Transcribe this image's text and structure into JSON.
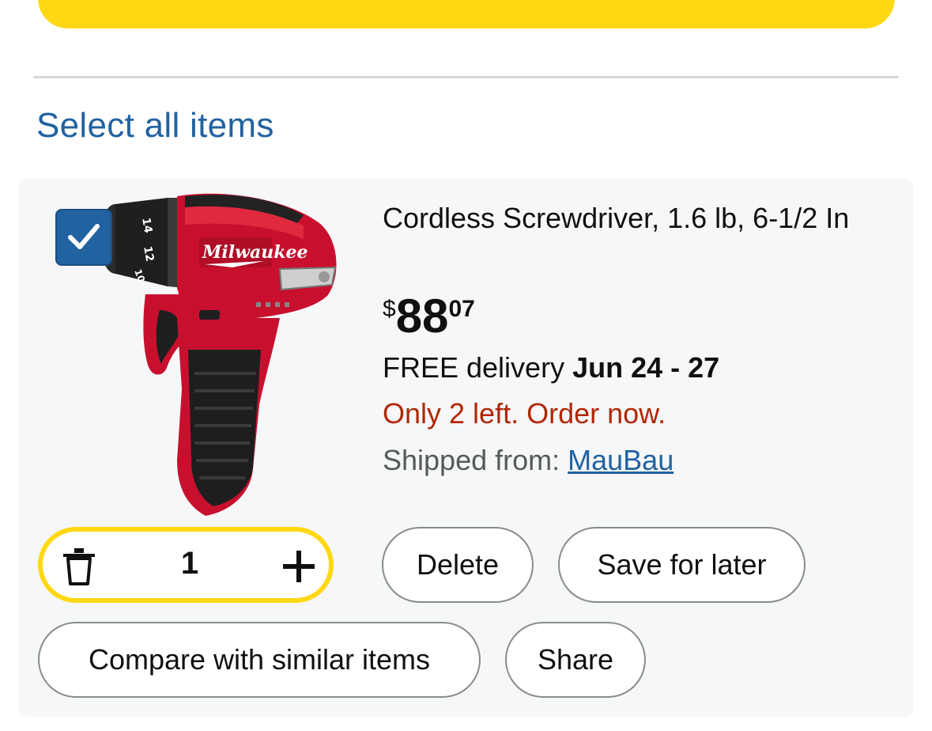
{
  "colors": {
    "checkout_bar": "#ffd814",
    "link_blue": "#2162a1",
    "stock_red": "#b12704",
    "card_bg": "#f6f7f9"
  },
  "cart": {
    "select_all_label": "Select all items",
    "item": {
      "selected": true,
      "image_icon": "cordless-screwdriver-image",
      "title": "Cordless Screwdriver, 1.6 lb, 6-1/2 In",
      "price": {
        "symbol": "$",
        "whole": "88",
        "fraction": "07"
      },
      "delivery": {
        "prefix": "FREE delivery",
        "dates": "Jun 24 - 27"
      },
      "stock_message": "Only 2 left. Order now.",
      "shipped_from_label": "Shipped from:",
      "seller": "MauBau",
      "quantity": "1",
      "actions": {
        "delete": "Delete",
        "save_for_later": "Save for later",
        "compare": "Compare with similar items",
        "share": "Share"
      }
    }
  }
}
